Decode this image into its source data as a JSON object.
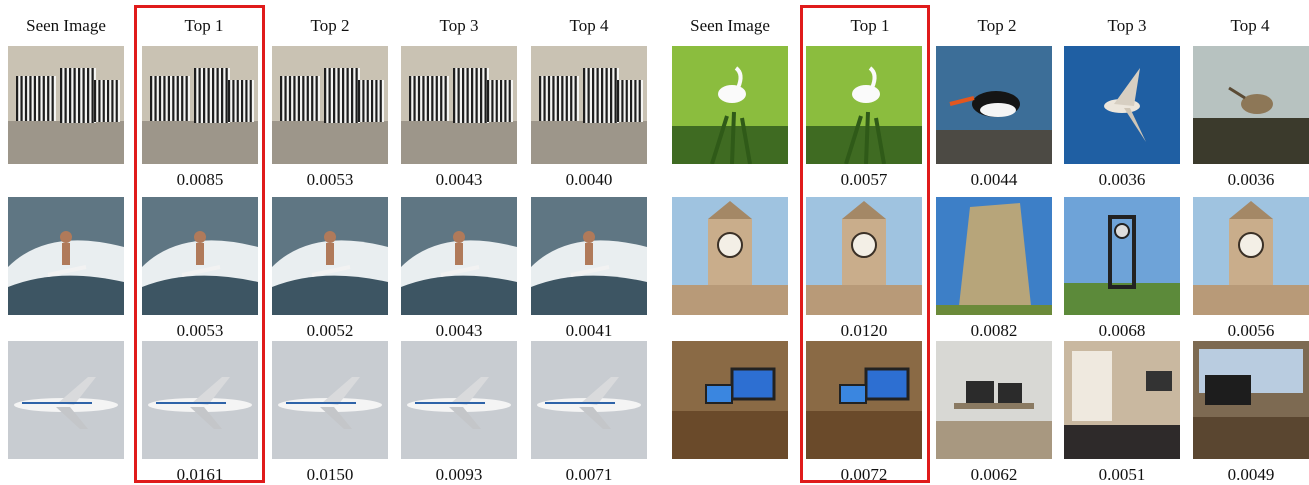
{
  "figure": {
    "left_panel": {
      "headers": [
        "Seen Image",
        "Top 1",
        "Top 2",
        "Top 3",
        "Top 4"
      ],
      "rows": [
        {
          "seen_icon": "zebra-herd-image",
          "results": [
            {
              "icon": "zebra-herd-image",
              "score": "0.0085"
            },
            {
              "icon": "zebra-herd-image",
              "score": "0.0053"
            },
            {
              "icon": "zebra-herd-image",
              "score": "0.0043"
            },
            {
              "icon": "zebra-herd-image",
              "score": "0.0040"
            }
          ]
        },
        {
          "seen_icon": "surfer-image",
          "results": [
            {
              "icon": "surfer-image",
              "score": "0.0053"
            },
            {
              "icon": "surfer-image",
              "score": "0.0052"
            },
            {
              "icon": "surfer-image",
              "score": "0.0043"
            },
            {
              "icon": "surfer-image",
              "score": "0.0041"
            }
          ]
        },
        {
          "seen_icon": "airplane-image",
          "results": [
            {
              "icon": "airplane-image",
              "score": "0.0161"
            },
            {
              "icon": "airplane-image",
              "score": "0.0150"
            },
            {
              "icon": "airplane-image",
              "score": "0.0093"
            },
            {
              "icon": "airplane-image",
              "score": "0.0071"
            }
          ]
        }
      ]
    },
    "right_panel": {
      "headers": [
        "Seen Image",
        "Top 1",
        "Top 2",
        "Top 3",
        "Top 4"
      ],
      "rows": [
        {
          "seen_icon": "egret-bird-image",
          "results": [
            {
              "icon": "egret-bird-image",
              "score": "0.0057"
            },
            {
              "icon": "oystercatcher-bird-image",
              "score": "0.0044"
            },
            {
              "icon": "flying-bird-image",
              "score": "0.0036"
            },
            {
              "icon": "wading-bird-image",
              "score": "0.0036"
            }
          ]
        },
        {
          "seen_icon": "clock-tower-image",
          "results": [
            {
              "icon": "clock-tower-image",
              "score": "0.0120"
            },
            {
              "icon": "stone-tower-image",
              "score": "0.0082"
            },
            {
              "icon": "clock-tower-frame-image",
              "score": "0.0068"
            },
            {
              "icon": "clock-tower-image",
              "score": "0.0056"
            }
          ]
        },
        {
          "seen_icon": "desk-computer-image",
          "results": [
            {
              "icon": "desk-computer-image",
              "score": "0.0072"
            },
            {
              "icon": "office-desk-image",
              "score": "0.0062"
            },
            {
              "icon": "bedroom-desk-image",
              "score": "0.0051"
            },
            {
              "icon": "desk-window-image",
              "score": "0.0049"
            }
          ]
        }
      ]
    },
    "colors": {
      "highlight_box": "#e01b1b"
    }
  }
}
